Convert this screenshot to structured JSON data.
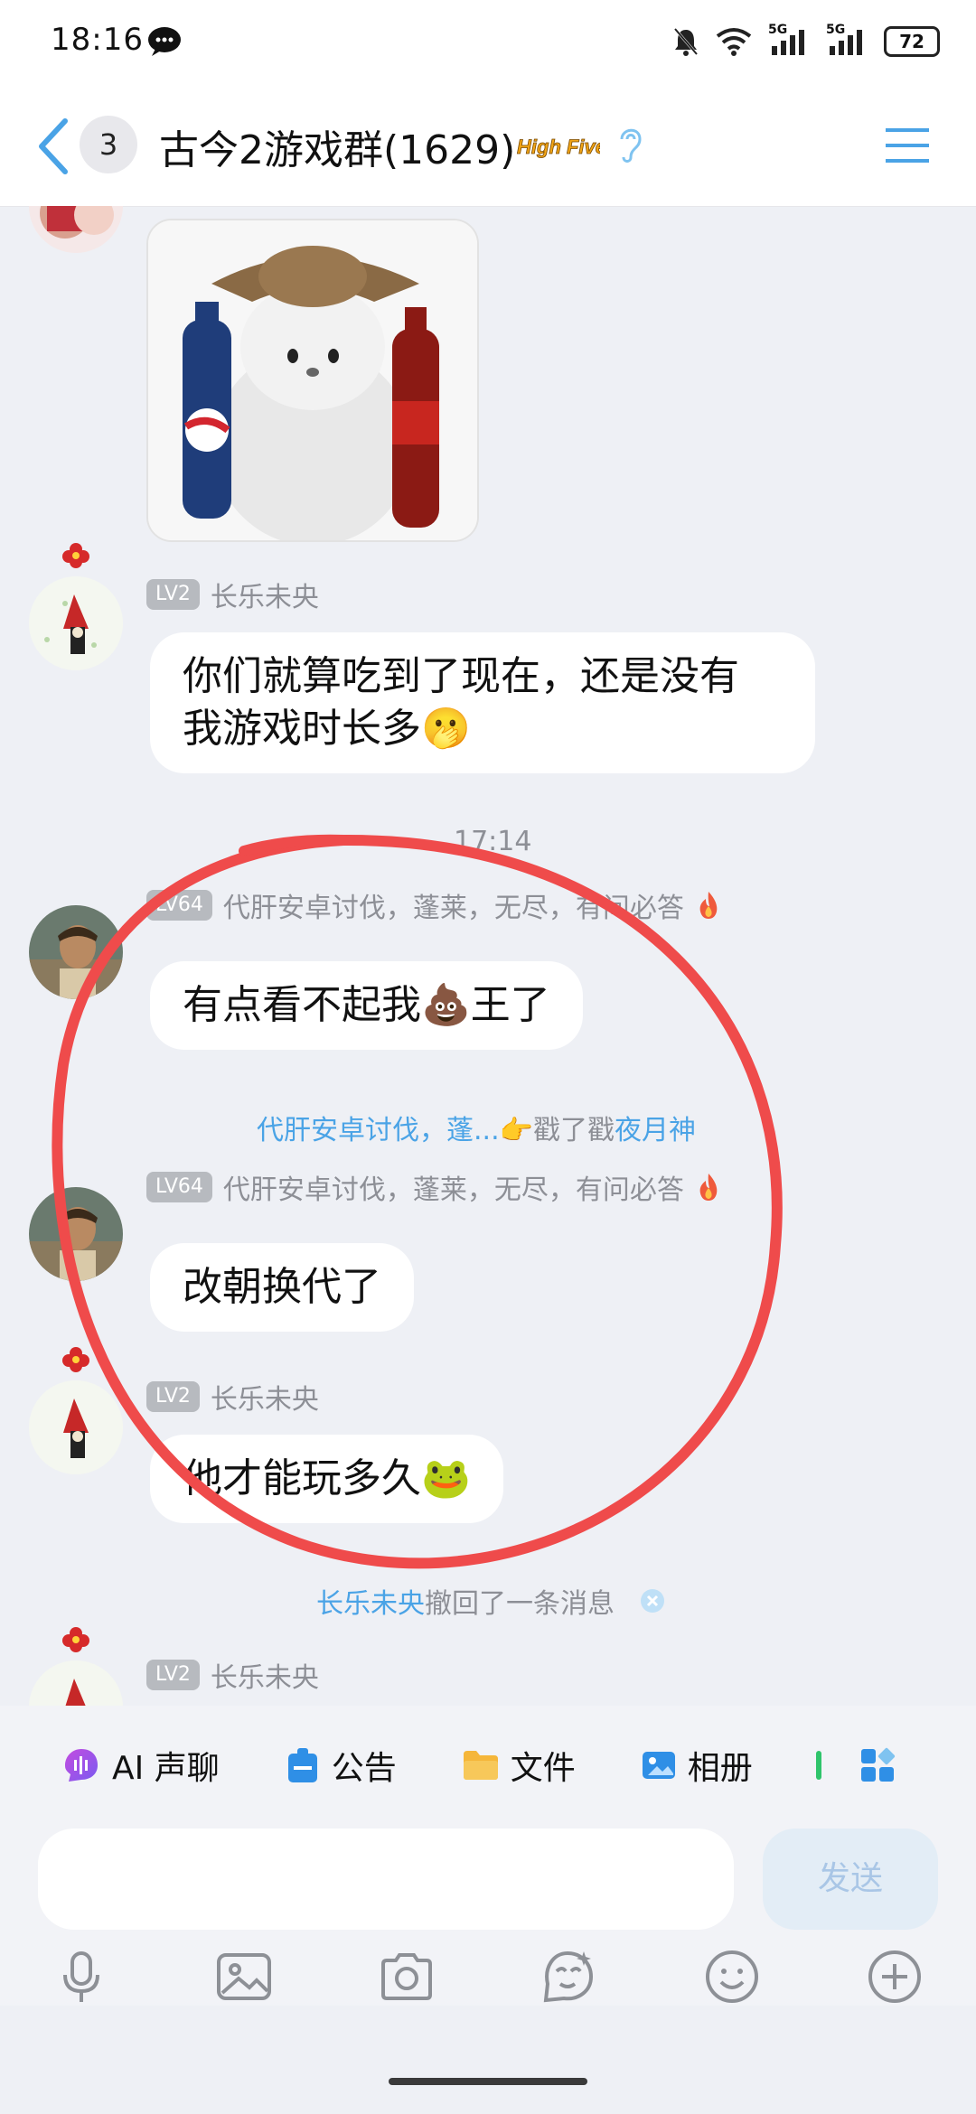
{
  "status_bar": {
    "time": "18:16",
    "battery": "72",
    "signal_labels": [
      "5G",
      "5G"
    ]
  },
  "header": {
    "unread_count": "3",
    "title": "古今2游戏群(1629)",
    "hot_badge_text": "High Five"
  },
  "messages": [
    {
      "type": "image",
      "description_icon": "cat-with-cola-sticker"
    },
    {
      "type": "text",
      "level": "LV2",
      "name": "长乐未央",
      "text_line1": "你们就算吃到了现在，还是没有",
      "text_line2": "我游戏时长多🫢"
    },
    {
      "type": "time",
      "text": "17:14"
    },
    {
      "type": "text",
      "level": "LV64",
      "name": "代肝安卓讨伐，蓬莱，无尽，有问必答",
      "text": "有点看不起我💩王了"
    },
    {
      "type": "poke",
      "actor": "代肝安卓讨伐，蓬...",
      "action": "戳了戳",
      "target": "夜月神"
    },
    {
      "type": "text",
      "level": "LV64",
      "name": "代肝安卓讨伐，蓬莱，无尽，有问必答",
      "text": "改朝换代了"
    },
    {
      "type": "text",
      "level": "LV2",
      "name": "长乐未央",
      "text": "他才能玩多久🐸"
    },
    {
      "type": "recall",
      "actor": "长乐未央",
      "action": "撤回了一条消息"
    },
    {
      "type": "partial",
      "level": "LV2",
      "name": "长乐未央"
    }
  ],
  "quick_actions": [
    {
      "label": "AI 声聊",
      "icon": "ai-voice-icon"
    },
    {
      "label": "公告",
      "icon": "announcement-icon"
    },
    {
      "label": "文件",
      "icon": "folder-icon"
    },
    {
      "label": "相册",
      "icon": "album-icon"
    }
  ],
  "input": {
    "placeholder": "",
    "send_label": "发送"
  },
  "colors": {
    "accent": "#4aa3e6",
    "annotation_circle": "#ef4b4b",
    "send_disabled_text": "#a9c6e6"
  }
}
